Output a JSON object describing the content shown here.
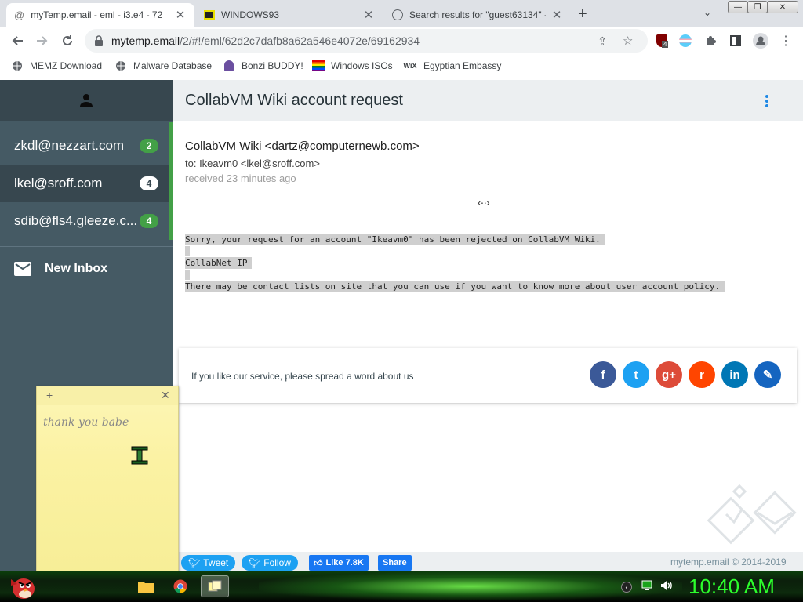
{
  "browser": {
    "tabs": [
      {
        "title": "myTemp.email - eml - i3.e4 - 72",
        "close": "✕",
        "active": true
      },
      {
        "title": "WINDOWS93",
        "close": "✕",
        "active": false
      },
      {
        "title": "Search results for \"guest63134\" -",
        "close": "✕",
        "active": false
      }
    ],
    "new_tab": "+",
    "tab_search": "⌄",
    "window_buttons": {
      "minimize": "—",
      "maximize": "❐",
      "close": "✕"
    },
    "address": {
      "domain": "mytemp.email",
      "path": "/2/#!/eml/62d2c7dafb8a62a546e4072e/69162934"
    },
    "extension_badge": "4",
    "bookmarks": [
      {
        "label": "MEMZ Download",
        "icon": "globe-icon"
      },
      {
        "label": "Malware Database",
        "icon": "globe-icon"
      },
      {
        "label": "Bonzi BUDDY!",
        "icon": "bonzi-icon"
      },
      {
        "label": "Windows ISOs",
        "icon": "flag-icon"
      },
      {
        "label": "Egyptian Embassy",
        "icon": "wix-icon",
        "icon_text": "WiX"
      }
    ]
  },
  "sidebar": {
    "accounts": [
      {
        "email": "zkdl@nezzart.com",
        "count": "2",
        "selected": false
      },
      {
        "email": "lkel@sroff.com",
        "count": "4",
        "selected": true
      },
      {
        "email": "sdib@fls4.gleeze.c...",
        "count": "4",
        "selected": false
      }
    ],
    "new_inbox": "New Inbox"
  },
  "message": {
    "subject": "CollabVM Wiki account request",
    "from": "CollabVM Wiki <dartz@computernewb.com>",
    "to": "to: Ikeavm0 <lkel@sroff.com>",
    "received": "received 23 minutes ago",
    "expand_symbol": "‹··›",
    "body": [
      "Sorry, your request for an account \"Ikeavm0\" has been rejected on CollabVM Wiki.",
      "CollabNet IP",
      "There may be contact lists on site that you can use if you want to know more about user account policy."
    ]
  },
  "share": {
    "text": "If you like our service, please spread a word about us",
    "networks": [
      {
        "name": "facebook",
        "glyph": "f",
        "color": "#3b5998"
      },
      {
        "name": "twitter",
        "glyph": "t",
        "color": "#1da1f2"
      },
      {
        "name": "google-plus",
        "glyph": "g+",
        "color": "#dd4b39"
      },
      {
        "name": "reddit",
        "glyph": "r",
        "color": "#ff4500"
      },
      {
        "name": "linkedin",
        "glyph": "in",
        "color": "#0077b5"
      },
      {
        "name": "pin",
        "glyph": "✎",
        "color": "#1565c0"
      }
    ]
  },
  "footer": {
    "tweet": "Tweet",
    "follow": "Follow",
    "like": "Like 7.8K",
    "share": "Share",
    "copyright": "mytemp.email © 2014-2019"
  },
  "sticky_note": {
    "add": "+",
    "close": "✕",
    "text": "thank you babe"
  },
  "taskbar": {
    "clock": "10:40 AM"
  }
}
